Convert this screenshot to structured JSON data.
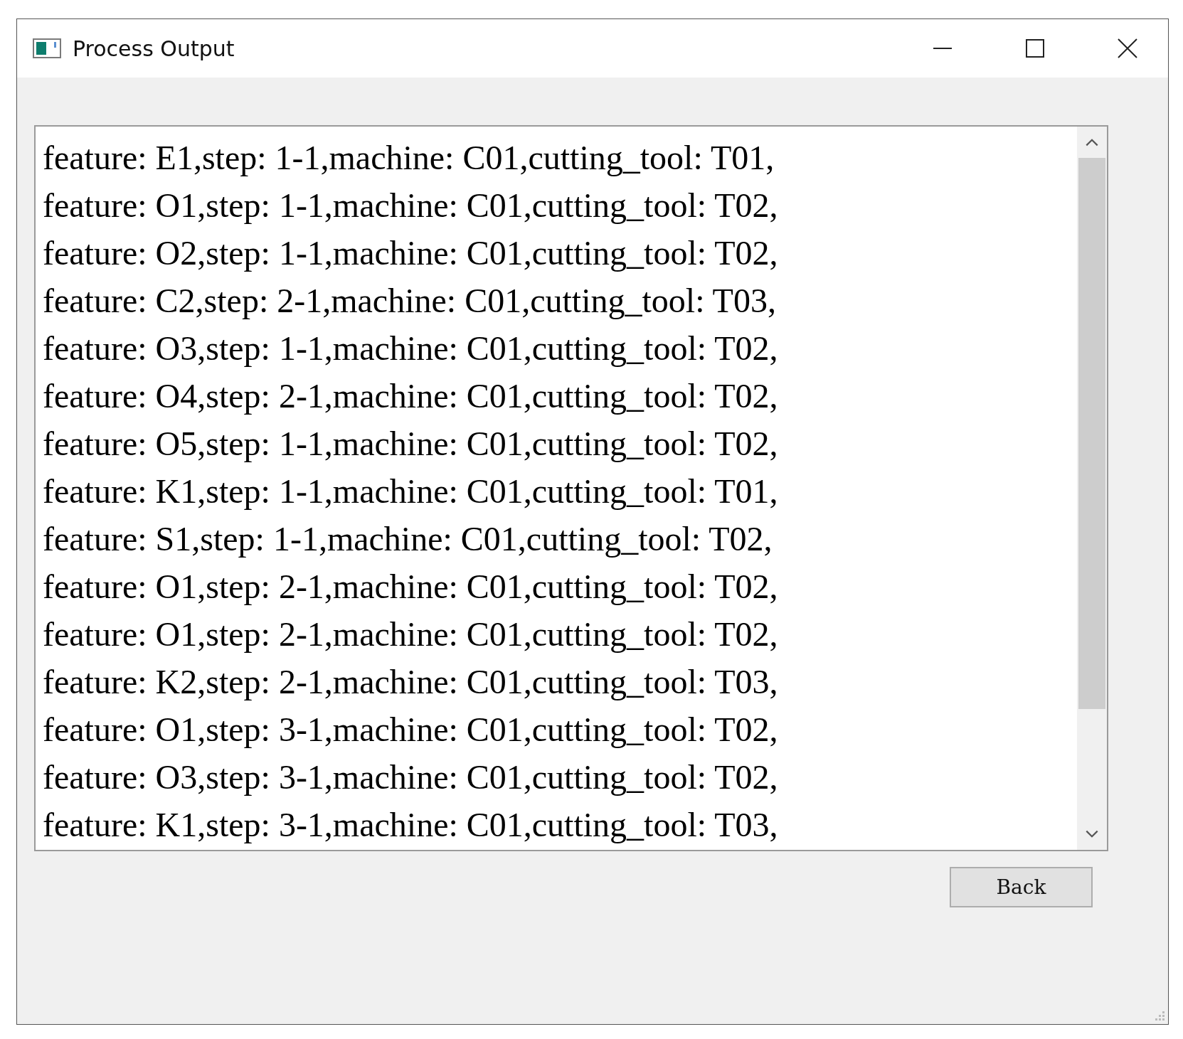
{
  "window": {
    "title": "Process Output"
  },
  "output_lines": [
    "feature: E1,step: 1-1,machine: C01,cutting_tool: T01,",
    "feature: O1,step: 1-1,machine: C01,cutting_tool: T02,",
    "feature: O2,step: 1-1,machine: C01,cutting_tool: T02,",
    "feature: C2,step: 2-1,machine: C01,cutting_tool: T03,",
    "feature: O3,step: 1-1,machine: C01,cutting_tool: T02,",
    "feature: O4,step: 2-1,machine: C01,cutting_tool: T02,",
    "feature: O5,step: 1-1,machine: C01,cutting_tool: T02,",
    "feature: K1,step: 1-1,machine: C01,cutting_tool: T01,",
    "feature: S1,step: 1-1,machine: C01,cutting_tool: T02,",
    "feature: O1,step: 2-1,machine: C01,cutting_tool: T02,",
    "feature: O1,step: 2-1,machine: C01,cutting_tool: T02,",
    "feature: K2,step: 2-1,machine: C01,cutting_tool: T03,",
    "feature: O1,step: 3-1,machine: C01,cutting_tool: T02,",
    "feature: O3,step: 3-1,machine: C01,cutting_tool: T02,",
    "feature: K1,step: 3-1,machine: C01,cutting_tool: T03,"
  ],
  "buttons": [
    {
      "label": "Back"
    }
  ]
}
